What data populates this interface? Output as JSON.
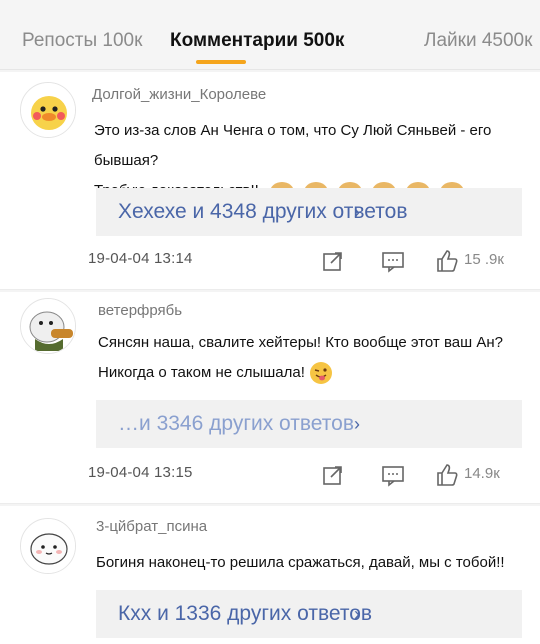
{
  "tabs": {
    "reposts": "Репосты 100к",
    "comments": "Комментарии 500к",
    "likes": "Лайки 4500к"
  },
  "comments": [
    {
      "author": "Долгой_жизни_Королеве",
      "line1": "Это из-за слов Ан Ченга о том, что Су Люй Сяньвей - его бывшая?",
      "line2": "Требую доказательств!!",
      "replies": "Хехехе и 4348 других ответов",
      "date": "19-04-04  13:14",
      "likes": "15 .9к"
    },
    {
      "author": "ветерфрябь",
      "line1": "Сянсян наша, свалите хейтеры! Кто вообще этот ваш Ан?",
      "line2": "Никогда о таком не слышала!",
      "replies": "…и 3346 других ответов",
      "date": "19-04-04  13:15",
      "likes": "14.9к"
    },
    {
      "author": "3-цйбрат_псина",
      "line1": "Богиня наконец-то решила сражаться, давай, мы с тобой!!",
      "replies": "Кхх и 1336 других ответов"
    }
  ],
  "colors": {
    "accent": "#f5a51c",
    "link": "#4a66a8"
  }
}
